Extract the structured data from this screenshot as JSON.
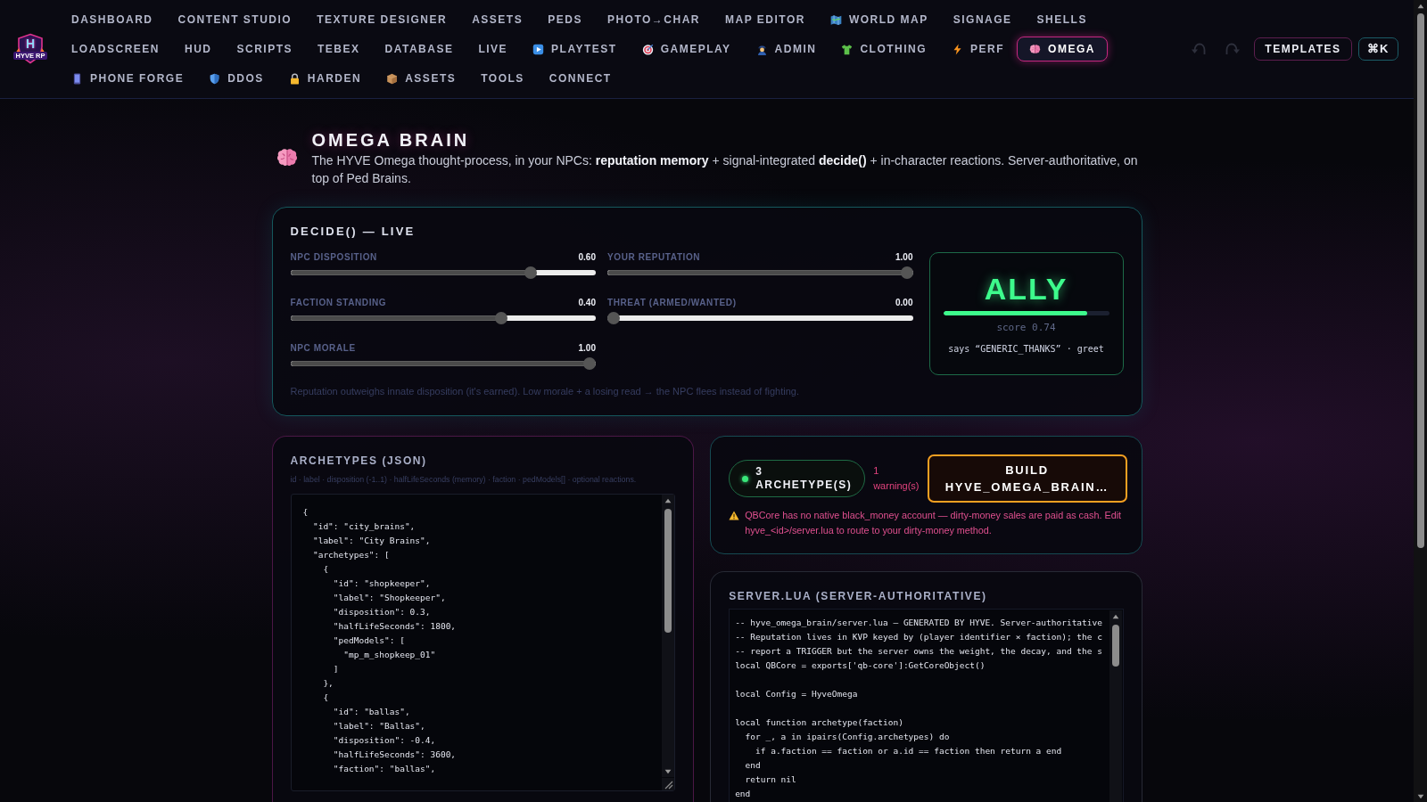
{
  "logo": {
    "letter": "H",
    "text": "HYVE RP"
  },
  "nav": [
    {
      "label": "DASHBOARD",
      "kind": "text",
      "selected": false
    },
    {
      "label": "CONTENT STUDIO",
      "kind": "text",
      "selected": false
    },
    {
      "label": "TEXTURE DESIGNER",
      "kind": "text",
      "selected": false
    },
    {
      "label": "ASSETS",
      "kind": "text",
      "selected": false
    },
    {
      "label": "PEDS",
      "kind": "text",
      "selected": false
    },
    {
      "label": "PHOTO→CHAR",
      "kind": "text",
      "selected": false
    },
    {
      "label": "MAP EDITOR",
      "kind": "text",
      "selected": false
    },
    {
      "label": "WORLD MAP",
      "kind": "map",
      "selected": false
    },
    {
      "label": "SIGNAGE",
      "kind": "text",
      "selected": false
    },
    {
      "label": "SHELLS",
      "kind": "text",
      "selected": false
    },
    {
      "label": "LOADSCREEN",
      "kind": "text",
      "selected": false
    },
    {
      "label": "HUD",
      "kind": "text",
      "selected": false
    },
    {
      "label": "SCRIPTS",
      "kind": "text",
      "selected": false
    },
    {
      "label": "TEBEX",
      "kind": "text",
      "selected": false
    },
    {
      "label": "DATABASE",
      "kind": "text",
      "selected": false
    },
    {
      "label": "LIVE",
      "kind": "text",
      "selected": false
    },
    {
      "label": "PLAYTEST",
      "kind": "play",
      "selected": false
    },
    {
      "label": "GAMEPLAY",
      "kind": "target",
      "selected": false
    },
    {
      "label": "ADMIN",
      "kind": "officer",
      "selected": false
    },
    {
      "label": "CLOTHING",
      "kind": "shirt",
      "selected": false
    },
    {
      "label": "PERF",
      "kind": "bolt",
      "selected": false
    },
    {
      "label": "OMEGA",
      "kind": "brain",
      "selected": true
    },
    {
      "label": "PHONE FORGE",
      "kind": "phone",
      "selected": false
    },
    {
      "label": "DDOS",
      "kind": "shield",
      "selected": false
    },
    {
      "label": "HARDEN",
      "kind": "lock",
      "selected": false
    },
    {
      "label": "ASSETS",
      "kind": "box",
      "selected": false
    },
    {
      "label": "TOOLS",
      "kind": "text",
      "selected": false
    },
    {
      "label": "CONNECT",
      "kind": "text",
      "selected": false
    }
  ],
  "history": [
    {
      "kind": "undo",
      "disabled": true
    },
    {
      "kind": "redo",
      "disabled": true
    }
  ],
  "actions": [
    {
      "kind": "templates",
      "label": "TEMPLATES"
    },
    {
      "kind": "palette",
      "label": "⌘K"
    }
  ],
  "header": {
    "title": "OMEGA BRAIN",
    "description": "The HYVE Omega thought-process, in your NPCs: **reputation memory** + signal-integrated **decide()** + in-character reactions. Server-authoritative, on top of Ped Brains."
  },
  "decide": {
    "title": "DECIDE() — LIVE",
    "sliders": [
      {
        "label": "NPC DISPOSITION",
        "value": "0.60",
        "level": 0.8
      },
      {
        "label": "YOUR REPUTATION",
        "value": "1.00",
        "level": 1
      },
      {
        "label": "FACTION STANDING",
        "value": "0.40",
        "level": 0.7
      },
      {
        "label": "THREAT (ARMED/WANTED)",
        "value": "0.00",
        "level": 0
      },
      {
        "label": "NPC MORALE",
        "value": "1.00",
        "level": 1
      }
    ],
    "result": {
      "verdict": "ALLY",
      "level": 0.87,
      "score": "score 0.74",
      "says": "says “GENERIC_THANKS” · greet"
    },
    "note": "Reputation outweighs innate disposition (it's earned). Low morale + a losing read → the NPC flees instead of fighting."
  },
  "archetypes": {
    "title": "ARCHETYPES (JSON)",
    "hint": "id · label · disposition (-1..1) · halfLifeSeconds (memory) · faction · pedModels[] · optional reactions.",
    "code": "{\n  \"id\": \"city_brains\",\n  \"label\": \"City Brains\",\n  \"archetypes\": [\n    {\n      \"id\": \"shopkeeper\",\n      \"label\": \"Shopkeeper\",\n      \"disposition\": 0.3,\n      \"halfLifeSeconds\": 1800,\n      \"pedModels\": [\n        \"mp_m_shopkeep_01\"\n      ]\n    },\n    {\n      \"id\": \"ballas\",\n      \"label\": \"Ballas\",\n      \"disposition\": -0.4,\n      \"halfLifeSeconds\": 3600,\n      \"faction\": \"ballas\","
  },
  "build": {
    "count": "3 ARCHETYPE(S)",
    "warnings": "1 warning(s)",
    "button": "BUILD HYVE_OMEGA_BRAIN…",
    "warning_message": "QBCore has no native black_money account — dirty-money sales are paid as cash. Edit hyve_<id>/server.lua to route to your dirty-money method."
  },
  "server": {
    "title": "SERVER.LUA (SERVER-AUTHORITATIVE)",
    "code": "-- hyve_omega_brain/server.lua — GENERATED BY HYVE. Server-authoritative\n-- Reputation lives in KVP keyed by (player identifier × faction); the c\n-- report a TRIGGER but the server owns the weight, the decay, and the s\nlocal QBCore = exports['qb-core']:GetCoreObject()\n\nlocal Config = HyveOmega\n\nlocal function archetype(faction)\n  for _, a in ipairs(Config.archetypes) do\n    if a.faction == faction or a.id == faction then return a end\n  end\n  return nil\nend"
  }
}
